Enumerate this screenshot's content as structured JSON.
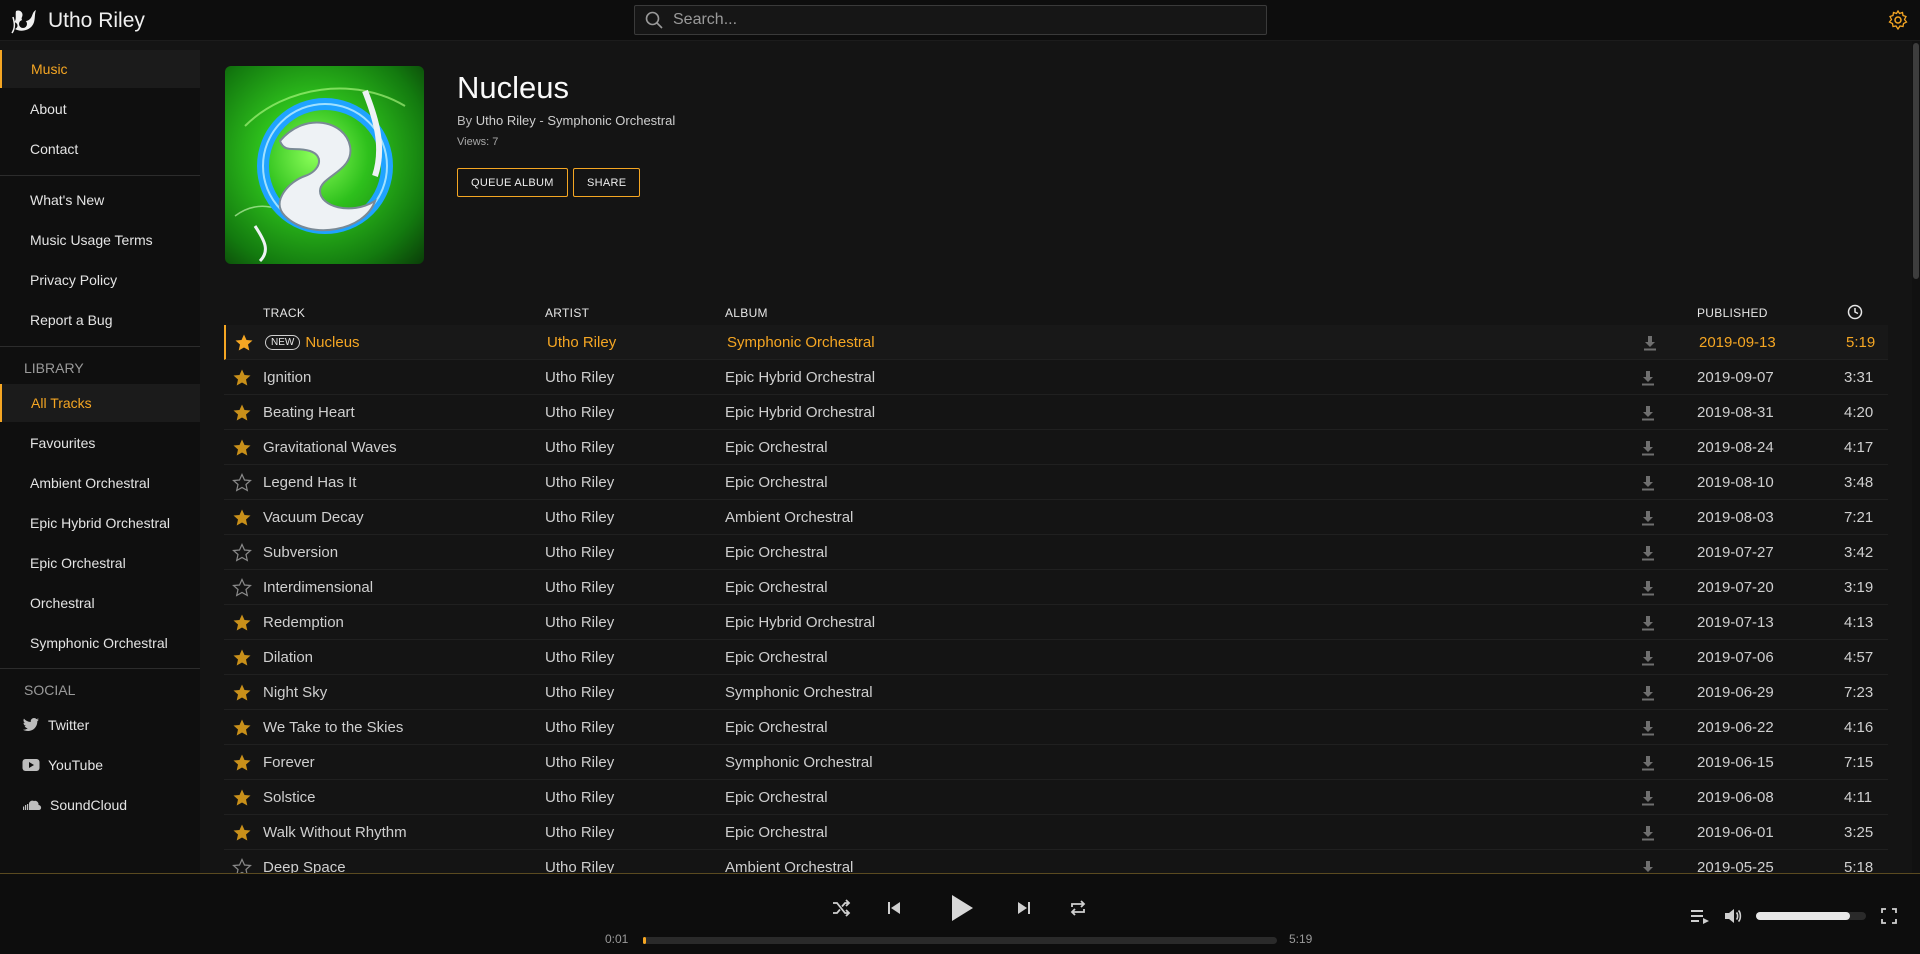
{
  "app": {
    "name": "Utho Riley"
  },
  "search": {
    "placeholder": "Search..."
  },
  "sidebar": {
    "main_items": [
      {
        "label": "Music",
        "active": true
      },
      {
        "label": "About"
      },
      {
        "label": "Contact"
      }
    ],
    "info_items": [
      {
        "label": "What's New"
      },
      {
        "label": "Music Usage Terms"
      },
      {
        "label": "Privacy Policy"
      },
      {
        "label": "Report a Bug"
      }
    ],
    "library_heading": "LIBRARY",
    "library_items": [
      {
        "label": "All Tracks",
        "active": true
      },
      {
        "label": "Favourites"
      },
      {
        "label": "Ambient Orchestral"
      },
      {
        "label": "Epic Hybrid Orchestral"
      },
      {
        "label": "Epic Orchestral"
      },
      {
        "label": "Orchestral"
      },
      {
        "label": "Symphonic Orchestral"
      }
    ],
    "social_heading": "SOCIAL",
    "social_items": [
      {
        "label": "Twitter",
        "icon": "twitter-icon"
      },
      {
        "label": "YouTube",
        "icon": "youtube-icon"
      },
      {
        "label": "SoundCloud",
        "icon": "soundcloud-icon"
      }
    ]
  },
  "album": {
    "title": "Nucleus",
    "by_prefix": "By",
    "artist": "Utho Riley",
    "separator": "-",
    "collection": "Symphonic Orchestral",
    "views": "Views: 7",
    "queue_label": "QUEUE ALBUM",
    "share_label": "SHARE"
  },
  "table": {
    "headers": {
      "track": "TRACK",
      "artist": "ARTIST",
      "album": "ALBUM",
      "published": "PUBLISHED"
    },
    "new_badge": "NEW",
    "rows": [
      {
        "track": "Nucleus",
        "artist": "Utho Riley",
        "album": "Symphonic Orchestral",
        "published": "2019-09-13",
        "duration": "5:19",
        "fav": true,
        "current": true,
        "new": true
      },
      {
        "track": "Ignition",
        "artist": "Utho Riley",
        "album": "Epic Hybrid Orchestral",
        "published": "2019-09-07",
        "duration": "3:31",
        "fav": true
      },
      {
        "track": "Beating Heart",
        "artist": "Utho Riley",
        "album": "Epic Hybrid Orchestral",
        "published": "2019-08-31",
        "duration": "4:20",
        "fav": true
      },
      {
        "track": "Gravitational Waves",
        "artist": "Utho Riley",
        "album": "Epic Orchestral",
        "published": "2019-08-24",
        "duration": "4:17",
        "fav": true
      },
      {
        "track": "Legend Has It",
        "artist": "Utho Riley",
        "album": "Epic Orchestral",
        "published": "2019-08-10",
        "duration": "3:48",
        "fav": false
      },
      {
        "track": "Vacuum Decay",
        "artist": "Utho Riley",
        "album": "Ambient Orchestral",
        "published": "2019-08-03",
        "duration": "7:21",
        "fav": true
      },
      {
        "track": "Subversion",
        "artist": "Utho Riley",
        "album": "Epic Orchestral",
        "published": "2019-07-27",
        "duration": "3:42",
        "fav": false
      },
      {
        "track": "Interdimensional",
        "artist": "Utho Riley",
        "album": "Epic Orchestral",
        "published": "2019-07-20",
        "duration": "3:19",
        "fav": false
      },
      {
        "track": "Redemption",
        "artist": "Utho Riley",
        "album": "Epic Hybrid Orchestral",
        "published": "2019-07-13",
        "duration": "4:13",
        "fav": true
      },
      {
        "track": "Dilation",
        "artist": "Utho Riley",
        "album": "Epic Orchestral",
        "published": "2019-07-06",
        "duration": "4:57",
        "fav": true
      },
      {
        "track": "Night Sky",
        "artist": "Utho Riley",
        "album": "Symphonic Orchestral",
        "published": "2019-06-29",
        "duration": "7:23",
        "fav": true
      },
      {
        "track": "We Take to the Skies",
        "artist": "Utho Riley",
        "album": "Epic Orchestral",
        "published": "2019-06-22",
        "duration": "4:16",
        "fav": true
      },
      {
        "track": "Forever",
        "artist": "Utho Riley",
        "album": "Symphonic Orchestral",
        "published": "2019-06-15",
        "duration": "7:15",
        "fav": true
      },
      {
        "track": "Solstice",
        "artist": "Utho Riley",
        "album": "Epic Orchestral",
        "published": "2019-06-08",
        "duration": "4:11",
        "fav": true
      },
      {
        "track": "Walk Without Rhythm",
        "artist": "Utho Riley",
        "album": "Epic Orchestral",
        "published": "2019-06-01",
        "duration": "3:25",
        "fav": true
      },
      {
        "track": "Deep Space",
        "artist": "Utho Riley",
        "album": "Ambient Orchestral",
        "published": "2019-05-25",
        "duration": "5:18",
        "fav": false
      }
    ]
  },
  "player": {
    "elapsed": "0:01",
    "total": "5:19",
    "progress_fraction": 0.003,
    "volume_fraction": 0.85
  },
  "colors": {
    "accent": "#f5a623",
    "background": "#141414",
    "sidebar": "#0f0f0f",
    "header": "#0d0d0d"
  }
}
